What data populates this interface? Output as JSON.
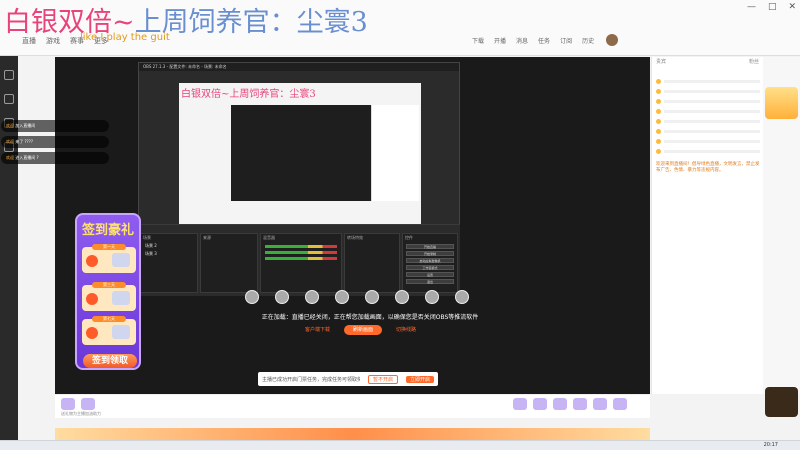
{
  "overlay": {
    "title_part1": "白银双倍~",
    "title_part2": "上周饲养官：尘寰3",
    "subtitle": "like I play the guit"
  },
  "browser": {
    "window_controls": [
      "—",
      "□",
      "✕"
    ]
  },
  "site_nav": {
    "items": [
      "直播",
      "游戏",
      "赛事",
      "更多"
    ]
  },
  "nav_right": {
    "items": [
      "下载",
      "开播",
      "消息",
      "任务",
      "订阅",
      "历史"
    ]
  },
  "obs": {
    "titlebar": "OBS 27.1.3 - 配置文件: 未命名 - 场景: 未命名",
    "inner_title": "白银双倍~上周饲养官：尘寰3",
    "docks": {
      "scenes": "场景",
      "sources": "来源",
      "mixer": "混音器",
      "transitions": "转场特效",
      "controls": "控件"
    },
    "source_items": [
      "场景 2",
      "场景 3"
    ],
    "control_buttons": [
      "开始直播",
      "开始录制",
      "启动虚拟摄像机",
      "工作室模式",
      "设置",
      "退出"
    ]
  },
  "notice": {
    "text": "正在加载：直播已经关闭，正在帮您加载画面，以确保您是否关闭OBS等推流软件",
    "download": "客户端下载",
    "btn_primary": "刷新画面",
    "btn_secondary": "切换线路"
  },
  "bottom_bar": {
    "label": "主播已成功开启门票任务，完成任务可领取奖励",
    "btn_left": "暂不开启",
    "btn_right": "立即开启"
  },
  "chat_overlay": [
    {
      "name": "欢迎",
      "text": "加入直播间"
    },
    {
      "name": "欢迎",
      "text": "来了 ????"
    },
    {
      "name": "欢迎",
      "text": "进入直播间 ?"
    }
  ],
  "signin": {
    "title": "签到豪礼",
    "days": [
      "第一天",
      "第三天",
      "第七天"
    ],
    "button": "签到领取"
  },
  "right_col": {
    "header_left": "贵宾",
    "header_right": "粉丝",
    "announcement": "欢迎来到直播间！倡导绿色直播，文明发言，禁止发布广告、色情、暴力等违规内容。"
  },
  "gift_bar": {
    "caption": "送礼物为主播加油助力"
  },
  "taskbar": {
    "clock": "20:17"
  },
  "colors": {
    "accent": "#ff6a2a",
    "title_pink": "#e8437a",
    "title_blue": "#6a8fd0",
    "signin_purple": "#7a45e0"
  }
}
